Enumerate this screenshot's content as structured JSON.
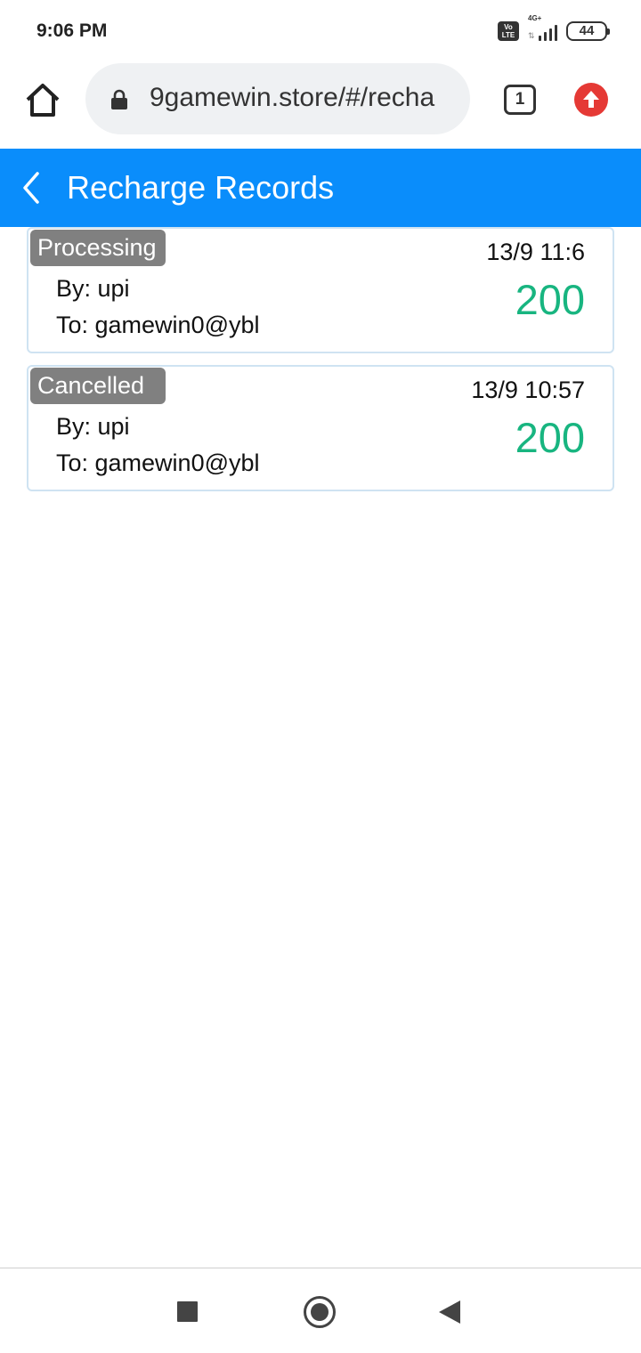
{
  "status_bar": {
    "time": "9:06 PM",
    "volte_label": "Vo LTE",
    "network_label": "4G+",
    "battery": "44"
  },
  "browser": {
    "url": "9gamewin.store/#/recha",
    "tab_count": "1"
  },
  "header": {
    "title": "Recharge Records"
  },
  "records": [
    {
      "status": "Processing",
      "time": "13/9 11:6",
      "by": "By: upi",
      "to": "To: gamewin0@ybl",
      "amount": "200"
    },
    {
      "status": "Cancelled",
      "time": "13/9 10:57",
      "by": "By: upi",
      "to": "To: gamewin0@ybl",
      "amount": "200"
    }
  ],
  "colors": {
    "header_bg": "#0a8dfb",
    "amount": "#18b580",
    "badge_bg": "#808080",
    "update_icon": "#e53935"
  },
  "icons": {
    "home": "home-icon",
    "lock": "lock-icon",
    "tabs": "tabs-icon",
    "update": "arrow-up-icon",
    "back": "chevron-left-icon",
    "nav_recents": "square-icon",
    "nav_home": "circle-icon",
    "nav_back": "triangle-back-icon"
  }
}
